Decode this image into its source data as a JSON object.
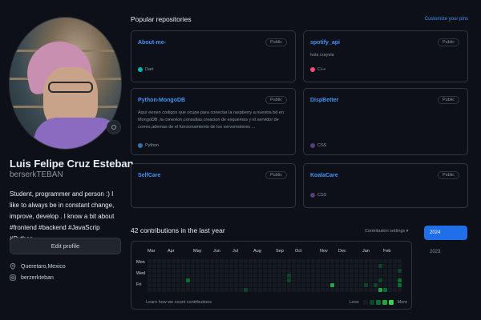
{
  "profile": {
    "fullname": "Luis Felipe Cruz Esteban",
    "username": "berserkTEBAN",
    "bio": "Student, programmer and person :) I like to always be in constant change, improve, develop . I know a bit about #frontend #backend #JavaScrip #Python",
    "edit_label": "Edit profile",
    "location": "Queretaro,Mexico",
    "social": "berzerkteban"
  },
  "repos": {
    "title": "Popular repositories",
    "customize_label": "Customize your pins",
    "items": [
      {
        "name": "About-me-",
        "visibility": "Public",
        "desc": "",
        "lang": "Dart",
        "lang_color": "#00B4AB"
      },
      {
        "name": "spotify_api",
        "visibility": "Public",
        "desc": "hola crayola",
        "lang": "C++",
        "lang_color": "#f34b7d"
      },
      {
        "name": "Python-MongoDB",
        "visibility": "Public",
        "desc": "Aqui vienen codigos que ocupe para conectar la raspberry a nuestra bd en MongoDB ,la conexion,consultas,creacion de esquemas y el servidor de correo,ademas de el funcionamiento de los servomotores ...",
        "lang": "Python",
        "lang_color": "#3572A5"
      },
      {
        "name": "DispBetter",
        "visibility": "Public",
        "desc": "",
        "lang": "CSS",
        "lang_color": "#563d7c"
      },
      {
        "name": "SelfCare",
        "visibility": "Public",
        "desc": "",
        "lang": "",
        "lang_color": ""
      },
      {
        "name": "KoalaCare",
        "visibility": "Public",
        "desc": "",
        "lang": "CSS",
        "lang_color": "#563d7c"
      }
    ]
  },
  "contributions": {
    "title": "42 contributions in the last year",
    "settings_label": "Contribution settings ▾",
    "months": [
      "Mar",
      "Apr",
      "May",
      "Jun",
      "Jul",
      "Aug",
      "Sep",
      "Oct",
      "Nov",
      "Dec",
      "Jan",
      "Feb"
    ],
    "days": [
      "Mon",
      "Wed",
      "Fri"
    ],
    "learn_label": "Learn how we count contributions",
    "legend_less": "Less",
    "legend_more": "More",
    "legend_colors": [
      "#161b22",
      "#0e4429",
      "#006d32",
      "#26a641",
      "#39d353"
    ]
  },
  "years": {
    "active": "2024",
    "other": "2023"
  },
  "icons": {
    "location": "location-icon",
    "social": "instagram-icon",
    "status": "smiley-icon"
  }
}
